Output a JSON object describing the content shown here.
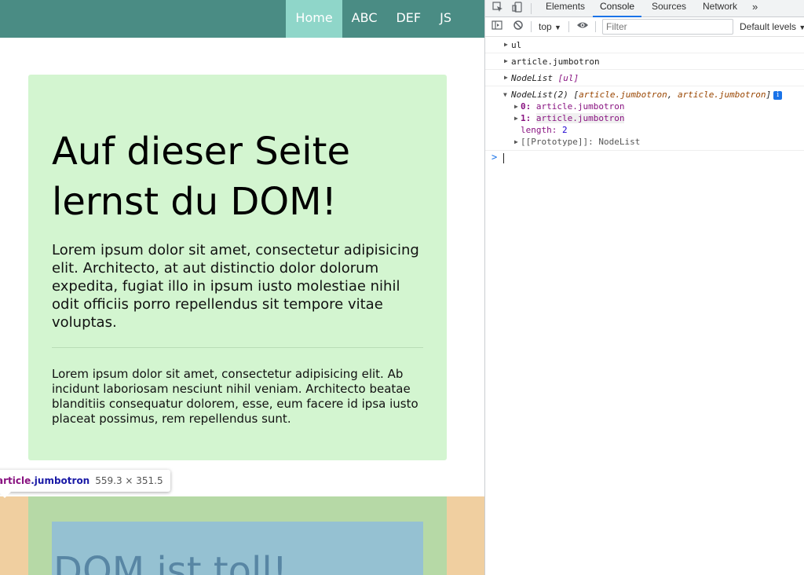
{
  "nav": {
    "items": [
      "Home",
      "ABC",
      "DEF",
      "JS"
    ]
  },
  "jumbotron": {
    "heading": "Auf dieser Seite lernst du DOM!",
    "lead": "Lorem ipsum dolor sit amet, consectetur adipisicing elit. Architecto, at aut distinctio dolor dolorum expedita, fugiat illo in ipsum iusto molestiae nihil odit officiis porro repellendus sit tempore vitae voluptas.",
    "body": "Lorem ipsum dolor sit amet, consectetur adipisicing elit. Ab incidunt laboriosam nesciunt nihil veniam. Architecto beatae blanditiis consequatur dolorem, esse, eum facere id ipsa iusto placeat possimus, rem repellendus sunt."
  },
  "jumbotron2": {
    "heading": "DOM ist toll!"
  },
  "tooltip": {
    "tag": "article",
    "cls": ".jumbotron",
    "dims": "559.3 × 351.5"
  },
  "devtools": {
    "tabs": [
      "Elements",
      "Console",
      "Sources",
      "Network"
    ],
    "more": "»",
    "context": "top",
    "filter_placeholder": "Filter",
    "levels": "Default levels"
  },
  "console": {
    "line1": "ul",
    "line2": "article.jumbotron",
    "line3": {
      "name": "NodeList",
      "item": "[ul]"
    },
    "line4": {
      "name": "NodeList(2)",
      "open": "[",
      "item1": "article.jumbotron",
      "comma": ",",
      "item2": "article.jumbotron",
      "close": "]",
      "info": "i"
    },
    "children": [
      {
        "key": "0:",
        "value": "article.jumbotron"
      },
      {
        "key": "1:",
        "value": "article.jumbotron"
      }
    ],
    "length_key": "length:",
    "length_value": "2",
    "proto": "[[Prototype]]: NodeList",
    "prompt": ">"
  },
  "colors": {
    "nav_bg": "#4a8c84",
    "nav_active": "#8fd6c9",
    "jumbotron_bg": "#d3f5d0",
    "accent": "#1a73e8"
  }
}
